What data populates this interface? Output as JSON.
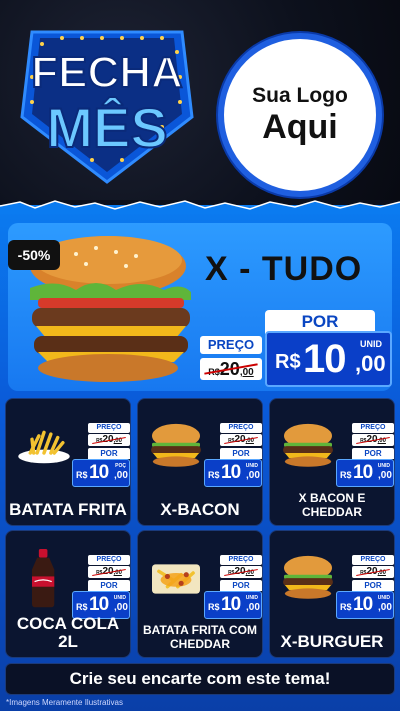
{
  "header": {
    "badge_line1": "FECHA",
    "badge_line2": "MÊS",
    "logo_line1": "Sua Logo",
    "logo_line2": "Aqui"
  },
  "hero": {
    "discount": "-50%",
    "name": "X - TUDO",
    "preco_label": "PREÇO",
    "old_currency": "R$",
    "old_int": "20",
    "old_dec": ",00",
    "por_label": "POR",
    "currency": "R$",
    "price_int": "10",
    "price_dec": ",00",
    "unit": "UNID"
  },
  "products": [
    {
      "name": "BATATA FRITA",
      "icon": "fries-icon",
      "preco_label": "PREÇO",
      "old_currency": "R$",
      "old_int": "20",
      "old_dec": ",00",
      "por_label": "POR",
      "currency": "R$",
      "price_int": "10",
      "price_dec": ",00",
      "unit": "POÇ"
    },
    {
      "name": "X-BACON",
      "icon": "burger-icon",
      "preco_label": "PREÇO",
      "old_currency": "R$",
      "old_int": "20",
      "old_dec": ",00",
      "por_label": "POR",
      "currency": "R$",
      "price_int": "10",
      "price_dec": ",00",
      "unit": "UNID"
    },
    {
      "name": "X BACON E CHEDDAR",
      "icon": "burger-icon",
      "preco_label": "PREÇO",
      "old_currency": "R$",
      "old_int": "20",
      "old_dec": ",00",
      "por_label": "POR",
      "currency": "R$",
      "price_int": "10",
      "price_dec": ",00",
      "unit": "UNID"
    },
    {
      "name": "COCA COLA 2L",
      "icon": "soda-bottle-icon",
      "preco_label": "PREÇO",
      "old_currency": "R$",
      "old_int": "20",
      "old_dec": ",00",
      "por_label": "POR",
      "currency": "R$",
      "price_int": "10",
      "price_dec": ",00",
      "unit": "UNID"
    },
    {
      "name": "BATATA FRITA COM CHEDDAR",
      "icon": "fries-cheddar-icon",
      "preco_label": "PREÇO",
      "old_currency": "R$",
      "old_int": "20",
      "old_dec": ",00",
      "por_label": "POR",
      "currency": "R$",
      "price_int": "10",
      "price_dec": ",00",
      "unit": "UNID"
    },
    {
      "name": "X-BURGUER",
      "icon": "burger-icon",
      "preco_label": "PREÇO",
      "old_currency": "R$",
      "old_int": "20",
      "old_dec": ",00",
      "por_label": "POR",
      "currency": "R$",
      "price_int": "10",
      "price_dec": ",00",
      "unit": "UNID"
    }
  ],
  "footer": {
    "cta": "Crie seu encarte com este tema!",
    "disclaimer": "*Imagens Meramente Ilustrativas"
  },
  "colors": {
    "accent": "#1f5fe0",
    "price_box": "#0a3fc8",
    "background": "#0b0f1c"
  }
}
